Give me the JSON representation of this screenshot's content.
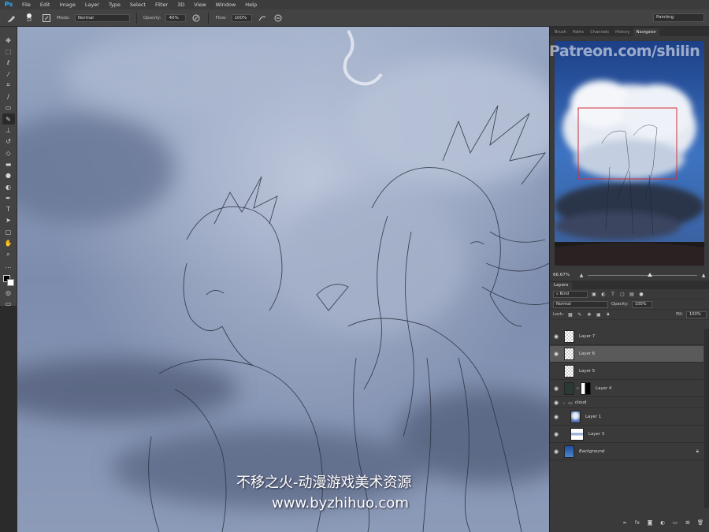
{
  "app": {
    "logo": "Ps",
    "menu": [
      "File",
      "Edit",
      "Image",
      "Layer",
      "Type",
      "Select",
      "Filter",
      "3D",
      "View",
      "Window",
      "Help"
    ]
  },
  "options": {
    "brush_size": "12",
    "mode_label": "Mode:",
    "mode_value": "Normal",
    "opacity_label": "Opacity:",
    "opacity_value": "40%",
    "flow_label": "Flow:",
    "flow_value": "100%",
    "workspace": "Painting"
  },
  "tools": [
    "move-tool",
    "marquee-tool",
    "lasso-tool",
    "quick-select-tool",
    "crop-tool",
    "eyedropper-tool",
    "healing-tool",
    "brush-tool",
    "stamp-tool",
    "history-brush-tool",
    "eraser-tool",
    "gradient-tool",
    "blur-tool",
    "dodge-tool",
    "pen-tool",
    "type-tool",
    "path-select-tool",
    "shape-tool",
    "hand-tool",
    "zoom-tool",
    "more-tools"
  ],
  "navigator": {
    "tabs": [
      "Brush",
      "Paths",
      "Channels",
      "History",
      "Navigator"
    ],
    "active_tab": "Navigator",
    "zoom": "66.67%"
  },
  "layers": {
    "tab": "Layers",
    "filter": "Kind",
    "blend_mode": "Normal",
    "opacity_label": "Opacity:",
    "opacity_value": "100%",
    "lock_label": "Lock:",
    "fill_label": "Fill:",
    "fill_value": "100%",
    "items": [
      {
        "name": "Layer 7",
        "visible": true,
        "selected": false,
        "thumb": "checker"
      },
      {
        "name": "Layer 6",
        "visible": true,
        "selected": true,
        "thumb": "checker"
      },
      {
        "name": "Layer 5",
        "visible": false,
        "selected": false,
        "thumb": "checker"
      },
      {
        "name": "Layer 4",
        "visible": true,
        "selected": false,
        "thumb": "dark"
      },
      {
        "name": "cloud",
        "visible": true,
        "selected": false,
        "thumb": "folder"
      },
      {
        "name": "Layer 1",
        "visible": true,
        "selected": false,
        "thumb": "sky"
      },
      {
        "name": "Layer 3",
        "visible": true,
        "selected": false,
        "thumb": "stripe"
      },
      {
        "name": "Background",
        "visible": true,
        "selected": false,
        "thumb": "blue"
      }
    ]
  },
  "colors": {
    "foreground": "#000000",
    "background": "#ffffff",
    "accent": "#31a8ff"
  },
  "watermarks": {
    "patreon": "Patreon.com/shilin",
    "title": "不移之火-动漫游戏美术资源",
    "url": "www.byzhihuo.com"
  }
}
